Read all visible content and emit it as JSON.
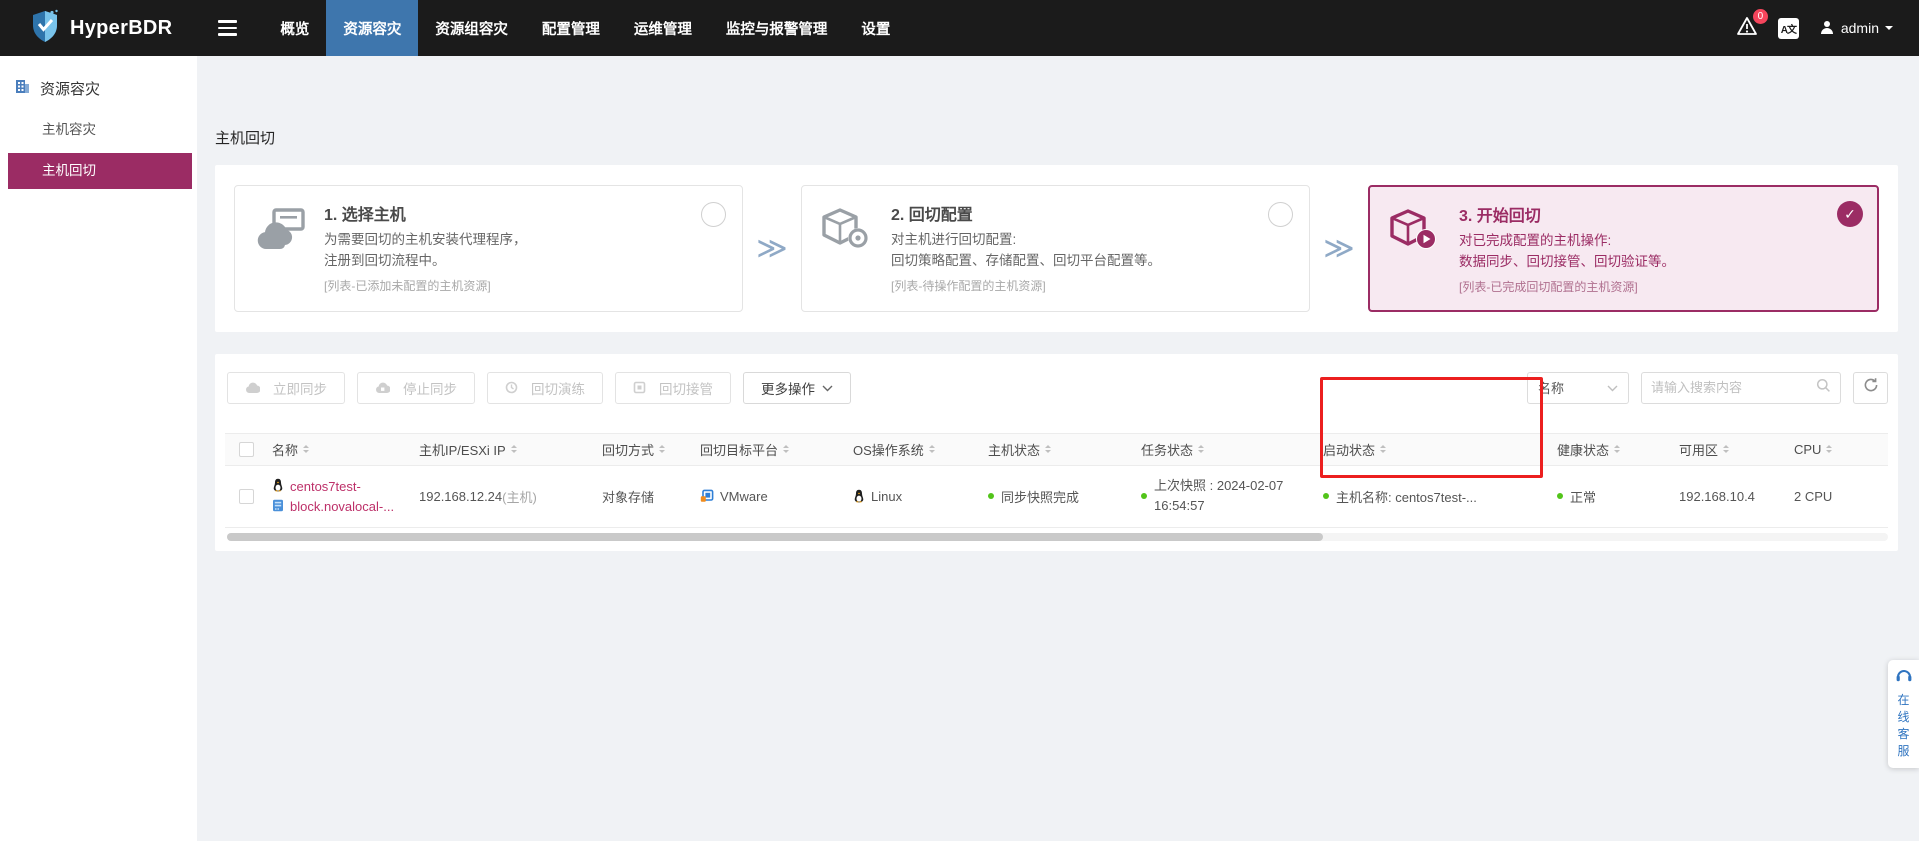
{
  "navbar": {
    "brand": "HyperBDR",
    "items": [
      {
        "label": "概览"
      },
      {
        "label": "资源容灾"
      },
      {
        "label": "资源组容灾"
      },
      {
        "label": "配置管理"
      },
      {
        "label": "运维管理"
      },
      {
        "label": "监控与报警管理"
      },
      {
        "label": "设置"
      }
    ],
    "alert_badge": "0",
    "language_icon_label": "A文",
    "username": "admin"
  },
  "sidebar": {
    "title": "资源容灾",
    "items": [
      {
        "label": "主机容灾"
      },
      {
        "label": "主机回切"
      }
    ]
  },
  "page": {
    "title": "主机回切"
  },
  "steps": [
    {
      "title": "1. 选择主机",
      "desc1": "为需要回切的主机安装代理程序，",
      "desc2": "注册到回切流程中。",
      "note": "[列表-已添加未配置的主机资源]"
    },
    {
      "title": "2. 回切配置",
      "desc1": "对主机进行回切配置:",
      "desc2": "回切策略配置、存储配置、回切平台配置等。",
      "note": "[列表-待操作配置的主机资源]"
    },
    {
      "title": "3. 开始回切",
      "desc1": "对已完成配置的主机操作:",
      "desc2": "数据同步、回切接管、回切验证等。",
      "note": "[列表-已完成回切配置的主机资源]"
    }
  ],
  "toolbar": {
    "sync_now": "立即同步",
    "stop_sync": "停止同步",
    "failback_drill": "回切演练",
    "failback_takeover": "回切接管",
    "more_actions": "更多操作",
    "filter_field": "名称",
    "search_placeholder": "请输入搜索内容"
  },
  "table": {
    "headers": [
      "名称",
      "主机IP/ESXi IP",
      "回切方式",
      "回切目标平台",
      "OS操作系统",
      "主机状态",
      "任务状态",
      "启动状态",
      "健康状态",
      "可用区",
      "CPU"
    ],
    "row": {
      "name_line1": "centos7test-",
      "name_line2": "block.novalocal-...",
      "ip": "192.168.12.24",
      "ip_suffix": "(主机)",
      "failback_method": "对象存储",
      "target_platform": "VMware",
      "os": "Linux",
      "host_status": "同步快照完成",
      "task_status_line1": "上次快照 : 2024-02-07",
      "task_status_line2": "16:54:57",
      "boot_status": "主机名称: centos7test-...",
      "health_status": "正常",
      "availability_zone": "192.168.10.4",
      "cpu": "2 CPU"
    }
  },
  "float_widget": {
    "label": "在线客服"
  },
  "colors": {
    "brand_maroon": "#9b2c64",
    "nav_active_blue": "#3e76ad",
    "success_green": "#52c41a",
    "annotation_red": "#ec1f1f"
  }
}
